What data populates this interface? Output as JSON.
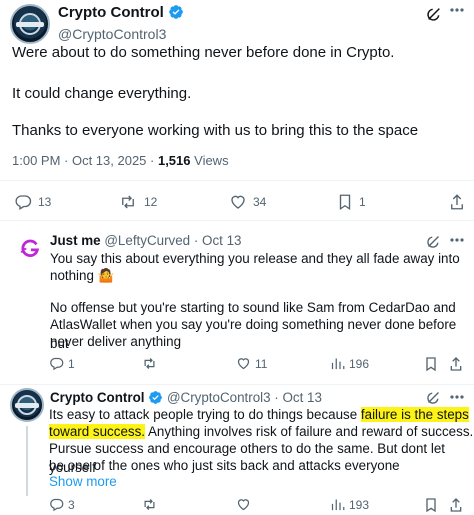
{
  "colors": {
    "accent": "#1d9bf0",
    "text": "#0f1419",
    "muted": "#536471",
    "highlight": "#fdf316",
    "divider": "#eff3f4"
  },
  "main_post": {
    "author_name": "Crypto Control",
    "author_handle": "@CryptoControl3",
    "verified_icon": "verified-badge-icon",
    "paragraphs": [
      "Were about to do something never before done in Crypto.",
      "It could change everything.",
      "Thanks to everyone working with us to bring this to the space"
    ],
    "timestamp": "1:00 PM · Oct 13, 2025 · ",
    "views_count": "1,516",
    "views_label": " Views",
    "actions": {
      "replies": "13",
      "reposts": "12",
      "likes": "34",
      "bookmarks": "1"
    }
  },
  "replies": [
    {
      "author_name": "Just me",
      "author_handle": "@LeftyCurved · Oct 13",
      "line1": "You say this about everything you release and they all fade away into",
      "line2": "nothing 🤷",
      "line3": "No offense but you're starting to sound like Sam from CedarDao and",
      "line4": "AtlasWallet when you say you're doing something never done before but",
      "line5": "never deliver anything",
      "actions": {
        "replies": "1",
        "reposts": "",
        "likes": "11",
        "views": "196"
      }
    },
    {
      "author_name": "Crypto Control",
      "author_handle": "@CryptoControl3 · Oct 13",
      "text_a": "Its easy to attack people trying to do things because ",
      "text_hl1": "failure is the steps",
      "text_hl2": "toward success.",
      "text_b": " Anything involves risk of failure and reward of success.",
      "line3": "Pursue success and encourage others to do the same. But dont let yourself",
      "line4": "be one of the ones who just sits back and attacks everyone",
      "show_more": "Show more",
      "actions": {
        "replies": "3",
        "reposts": "",
        "likes": "",
        "views": "193"
      }
    }
  ]
}
